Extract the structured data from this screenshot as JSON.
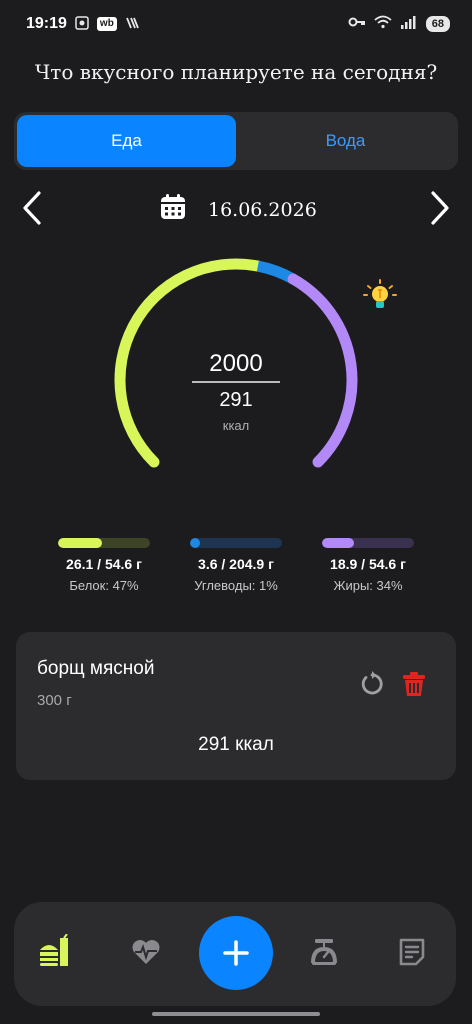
{
  "status": {
    "time": "19:19",
    "wb": "wb",
    "signal_superscript": "6",
    "battery": "68"
  },
  "heading": "Что вкусного планируете на сегодня?",
  "tabs": [
    {
      "label": "Еда",
      "active": true
    },
    {
      "label": "Вода",
      "active": false
    }
  ],
  "date": "16.06.2026",
  "gauge": {
    "goal": "2000",
    "consumed": "291",
    "unit": "ккал",
    "segments": [
      {
        "name": "protein",
        "color": "#d8f65a",
        "fraction": 0.47
      },
      {
        "name": "carbs",
        "color": "#1e88e5",
        "fraction": 0.01
      },
      {
        "name": "fat",
        "color": "#b388f7",
        "fraction": 0.34
      }
    ]
  },
  "macros": [
    {
      "value": "26.1 / 54.6 г",
      "label": "Белок: 47%",
      "color": "#d8f65a",
      "track": "#3d4325",
      "fraction": 0.478
    },
    {
      "value": "3.6 / 204.9 г",
      "label": "Углеводы: 1%",
      "color": "#1e88e5",
      "track": "#1e3552",
      "fraction": 0.018
    },
    {
      "value": "18.9 / 54.6 г",
      "label": "Жиры: 34%",
      "color": "#b388f7",
      "track": "#3a3050",
      "fraction": 0.346
    }
  ],
  "food": {
    "name": "борщ мясной",
    "weight": "300 г",
    "kcal": "291 ккал"
  },
  "icons": {
    "calendar": "calendar-icon",
    "refresh": "refresh-icon",
    "delete": "trash-icon",
    "bulb": "lightbulb-icon",
    "nav": [
      "food-icon",
      "heart-pulse-icon",
      "plus-icon",
      "scale-icon",
      "notes-icon"
    ]
  },
  "colors": {
    "accent": "#0a84ff",
    "delete": "#e0241f",
    "nav_active": "#d8f65a",
    "nav_inactive": "#8a8a8e"
  }
}
